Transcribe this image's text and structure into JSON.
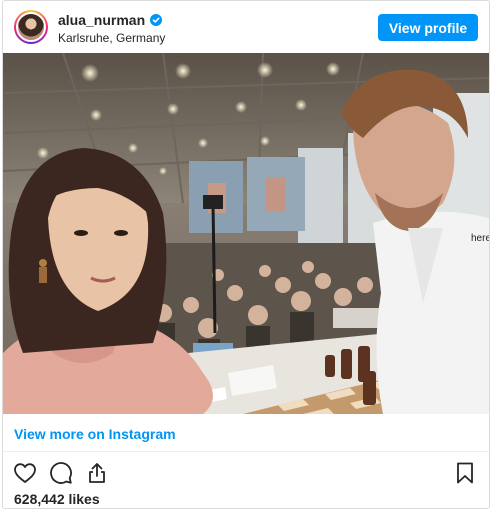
{
  "post": {
    "username": "alua_nurman",
    "location": "Karlsruhe, Germany",
    "view_profile_label": "View profile",
    "view_more_label": "View more on Instagram",
    "likes": "628,442 likes"
  },
  "photo": {
    "icon": "selfie-photo",
    "shirt_text": "here"
  },
  "icons": {
    "verified": "verified-badge-icon",
    "like": "heart-icon",
    "comment": "comment-icon",
    "share": "share-icon",
    "save": "bookmark-icon"
  },
  "colors": {
    "accent": "#0095f6",
    "text": "#262626",
    "border": "#dbdbdb"
  }
}
